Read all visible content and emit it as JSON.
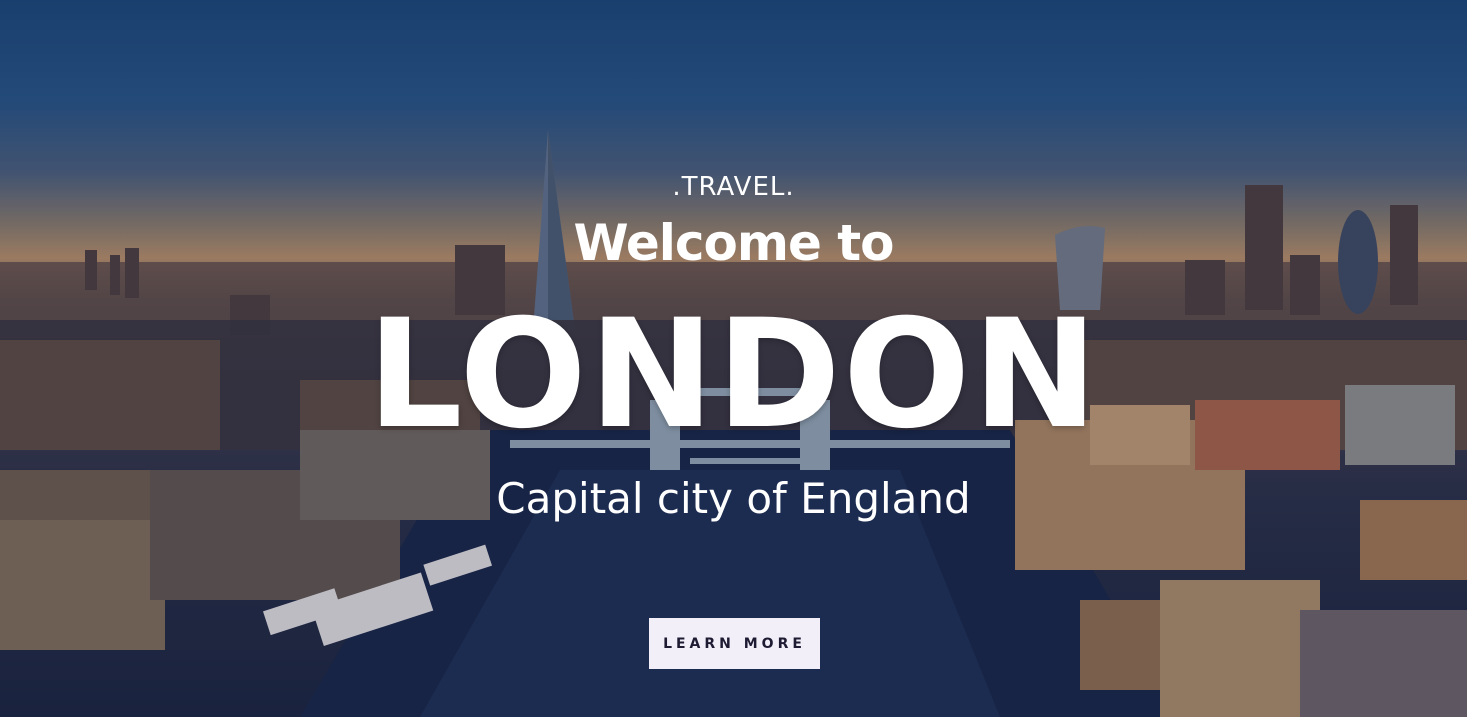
{
  "hero": {
    "eyebrow": ".TRAVEL.",
    "welcome": "Welcome to",
    "city": "LONDON",
    "tagline": "Capital city of England",
    "cta_label": "LEARN MORE"
  },
  "colors": {
    "sky_top": "#1c4677",
    "horizon": "#b08a68",
    "river": "#1c2540",
    "text": "#ffffff",
    "button_bg": "#f2eff9",
    "button_text": "#1e1b33"
  },
  "background_image": "london-aerial-skyline"
}
